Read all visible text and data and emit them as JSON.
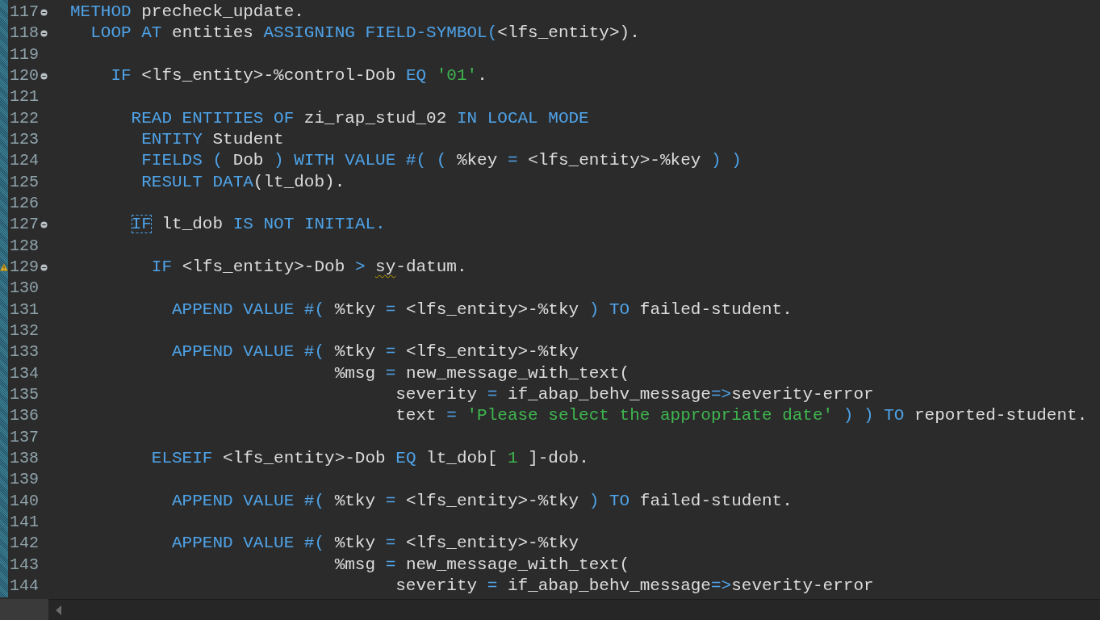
{
  "lines": [
    {
      "number": "117",
      "foldable": true,
      "warning": false,
      "tokens": [
        {
          "kind": "kw",
          "text": "METHOD"
        },
        {
          "kind": "id",
          "text": " precheck_update."
        }
      ]
    },
    {
      "number": "118",
      "foldable": true,
      "warning": false,
      "tokens": [
        {
          "kind": "kw",
          "text": "  LOOP AT"
        },
        {
          "kind": "id",
          "text": " entities "
        },
        {
          "kind": "kw",
          "text": "ASSIGNING FIELD-SYMBOL("
        },
        {
          "kind": "id",
          "text": "<lfs_entity>)."
        }
      ]
    },
    {
      "number": "119",
      "foldable": false,
      "warning": false
    },
    {
      "number": "120",
      "foldable": true,
      "warning": false,
      "tokens": [
        {
          "kind": "kw",
          "text": "    IF"
        },
        {
          "kind": "id",
          "text": " <lfs_entity>-%control-Dob "
        },
        {
          "kind": "kw",
          "text": "EQ "
        },
        {
          "kind": "str",
          "text": "'01'"
        },
        {
          "kind": "id",
          "text": "."
        }
      ]
    },
    {
      "number": "121",
      "foldable": false,
      "warning": false
    },
    {
      "number": "122",
      "foldable": false,
      "warning": false,
      "tokens": [
        {
          "kind": "kw",
          "text": "      READ ENTITIES OF"
        },
        {
          "kind": "id",
          "text": " zi_rap_stud_02 "
        },
        {
          "kind": "kw",
          "text": "IN LOCAL MODE"
        }
      ]
    },
    {
      "number": "123",
      "foldable": false,
      "warning": false,
      "tokens": [
        {
          "kind": "kw",
          "text": "       ENTITY"
        },
        {
          "kind": "id",
          "text": " Student"
        }
      ]
    },
    {
      "number": "124",
      "foldable": false,
      "warning": false,
      "tokens": [
        {
          "kind": "kw",
          "text": "       FIELDS ("
        },
        {
          "kind": "id",
          "text": " Dob "
        },
        {
          "kind": "kw",
          "text": ") WITH VALUE #( ("
        },
        {
          "kind": "id",
          "text": " %key "
        },
        {
          "kind": "kw",
          "text": "="
        },
        {
          "kind": "id",
          "text": " <lfs_entity>-%key "
        },
        {
          "kind": "kw",
          "text": ") )"
        }
      ]
    },
    {
      "number": "125",
      "foldable": false,
      "warning": false,
      "tokens": [
        {
          "kind": "kw",
          "text": "       RESULT DATA"
        },
        {
          "kind": "id",
          "text": "(lt_dob)."
        }
      ]
    },
    {
      "number": "126",
      "foldable": false,
      "warning": false
    },
    {
      "number": "127",
      "foldable": true,
      "warning": false,
      "tokens": [
        {
          "kind": "kw",
          "text": "      IF",
          "boxed": true
        },
        {
          "kind": "id",
          "text": " lt_dob "
        },
        {
          "kind": "kw",
          "text": "IS NOT INITIAL."
        }
      ]
    },
    {
      "number": "128",
      "foldable": false,
      "warning": false
    },
    {
      "number": "129",
      "foldable": true,
      "warning": true,
      "tokens": [
        {
          "kind": "kw",
          "text": "        IF"
        },
        {
          "kind": "id",
          "text": " <lfs_entity>-Dob "
        },
        {
          "kind": "kw",
          "text": "> "
        },
        {
          "kind": "id",
          "text": "sy",
          "underlined": true
        },
        {
          "kind": "id",
          "text": "-datum."
        }
      ]
    },
    {
      "number": "130",
      "foldable": false,
      "warning": false
    },
    {
      "number": "131",
      "foldable": false,
      "warning": false,
      "tokens": [
        {
          "kind": "kw",
          "text": "          APPEND VALUE #("
        },
        {
          "kind": "id",
          "text": " %tky "
        },
        {
          "kind": "kw",
          "text": "="
        },
        {
          "kind": "id",
          "text": " <lfs_entity>-%tky "
        },
        {
          "kind": "kw",
          "text": ") TO"
        },
        {
          "kind": "id",
          "text": " failed-student."
        }
      ]
    },
    {
      "number": "132",
      "foldable": false,
      "warning": false
    },
    {
      "number": "133",
      "foldable": false,
      "warning": false,
      "tokens": [
        {
          "kind": "kw",
          "text": "          APPEND VALUE #("
        },
        {
          "kind": "id",
          "text": " %tky "
        },
        {
          "kind": "kw",
          "text": "="
        },
        {
          "kind": "id",
          "text": " <lfs_entity>-%tky"
        }
      ]
    },
    {
      "number": "134",
      "foldable": false,
      "warning": false,
      "tokens": [
        {
          "kind": "id",
          "text": "                          %msg "
        },
        {
          "kind": "kw",
          "text": "="
        },
        {
          "kind": "id",
          "text": " new_message_with_text("
        }
      ]
    },
    {
      "number": "135",
      "foldable": false,
      "warning": false,
      "tokens": [
        {
          "kind": "id",
          "text": "                                severity "
        },
        {
          "kind": "kw",
          "text": "="
        },
        {
          "kind": "id",
          "text": " if_abap_behv_message"
        },
        {
          "kind": "kw",
          "text": "=>"
        },
        {
          "kind": "id",
          "text": "severity-error"
        }
      ]
    },
    {
      "number": "136",
      "foldable": false,
      "warning": false,
      "tokens": [
        {
          "kind": "id",
          "text": "                                text "
        },
        {
          "kind": "kw",
          "text": "= "
        },
        {
          "kind": "str",
          "text": "'Please select the appropriate date'"
        },
        {
          "kind": "kw",
          "text": " ) ) TO"
        },
        {
          "kind": "id",
          "text": " reported-student."
        }
      ]
    },
    {
      "number": "137",
      "foldable": false,
      "warning": false
    },
    {
      "number": "138",
      "foldable": false,
      "warning": false,
      "tokens": [
        {
          "kind": "kw",
          "text": "        ELSEIF"
        },
        {
          "kind": "id",
          "text": " <lfs_entity>-Dob "
        },
        {
          "kind": "kw",
          "text": "EQ"
        },
        {
          "kind": "id",
          "text": " lt_dob[ "
        },
        {
          "kind": "str",
          "text": "1"
        },
        {
          "kind": "id",
          "text": " ]-dob."
        }
      ]
    },
    {
      "number": "139",
      "foldable": false,
      "warning": false
    },
    {
      "number": "140",
      "foldable": false,
      "warning": false,
      "tokens": [
        {
          "kind": "kw",
          "text": "          APPEND VALUE #("
        },
        {
          "kind": "id",
          "text": " %tky "
        },
        {
          "kind": "kw",
          "text": "="
        },
        {
          "kind": "id",
          "text": " <lfs_entity>-%tky "
        },
        {
          "kind": "kw",
          "text": ") TO"
        },
        {
          "kind": "id",
          "text": " failed-student."
        }
      ]
    },
    {
      "number": "141",
      "foldable": false,
      "warning": false
    },
    {
      "number": "142",
      "foldable": false,
      "warning": false,
      "tokens": [
        {
          "kind": "kw",
          "text": "          APPEND VALUE #("
        },
        {
          "kind": "id",
          "text": " %tky "
        },
        {
          "kind": "kw",
          "text": "="
        },
        {
          "kind": "id",
          "text": " <lfs_entity>-%tky"
        }
      ]
    },
    {
      "number": "143",
      "foldable": false,
      "warning": false,
      "tokens": [
        {
          "kind": "id",
          "text": "                          %msg "
        },
        {
          "kind": "kw",
          "text": "="
        },
        {
          "kind": "id",
          "text": " new_message_with_text("
        }
      ]
    },
    {
      "number": "144",
      "foldable": false,
      "warning": false,
      "tokens": [
        {
          "kind": "id",
          "text": "                                severity "
        },
        {
          "kind": "kw",
          "text": "="
        },
        {
          "kind": "id",
          "text": " if_abap_behv_message"
        },
        {
          "kind": "kw",
          "text": "=>"
        },
        {
          "kind": "id",
          "text": "severity-error"
        }
      ]
    }
  ]
}
